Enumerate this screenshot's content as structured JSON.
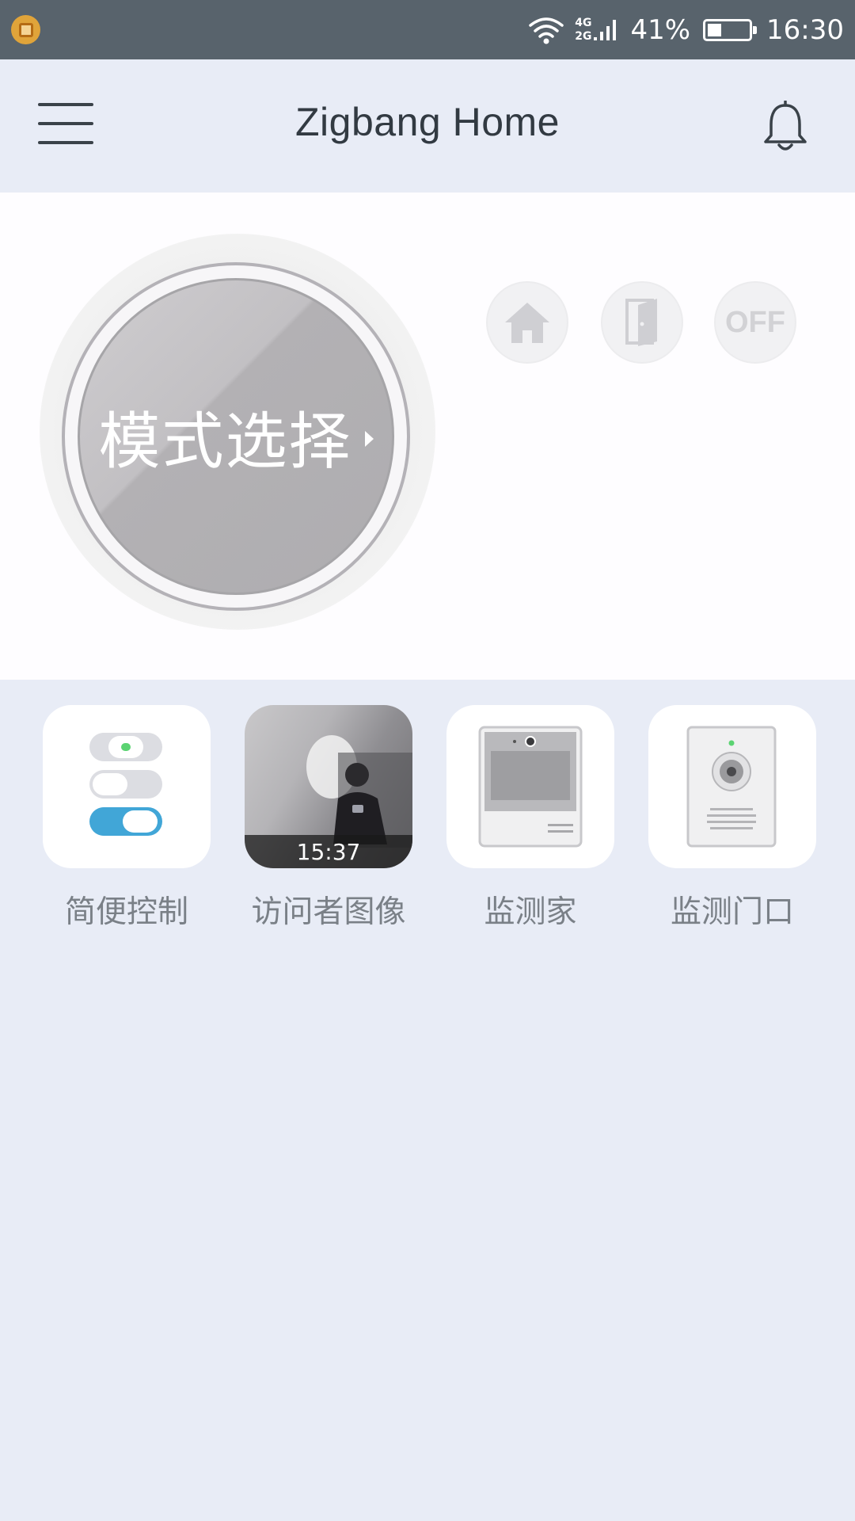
{
  "status_bar": {
    "network_top": "4G",
    "network_bottom": "2G",
    "battery_percent_text": "41%",
    "battery_level": 0.41,
    "time": "16:30",
    "app_icon": "notification-app-icon"
  },
  "header": {
    "title": "Zigbang Home",
    "menu_icon": "hamburger-menu-icon",
    "bell_icon": "bell-icon"
  },
  "mode": {
    "select_label": "模式选择",
    "options": [
      {
        "icon": "home-icon"
      },
      {
        "icon": "door-icon"
      },
      {
        "label": "OFF"
      }
    ]
  },
  "tiles": [
    {
      "label": "简便控制",
      "icon": "toggle-switches-icon"
    },
    {
      "label": "访问者图像",
      "time": "15:37"
    },
    {
      "label": "监测家",
      "icon": "intercom-monitor-icon"
    },
    {
      "label": "监测门口",
      "icon": "door-camera-icon"
    }
  ],
  "colors": {
    "status_bar": "#58636c",
    "background": "#e8ecf6",
    "toggle_active": "#41a6d7",
    "indicator_green": "#5bd372"
  }
}
